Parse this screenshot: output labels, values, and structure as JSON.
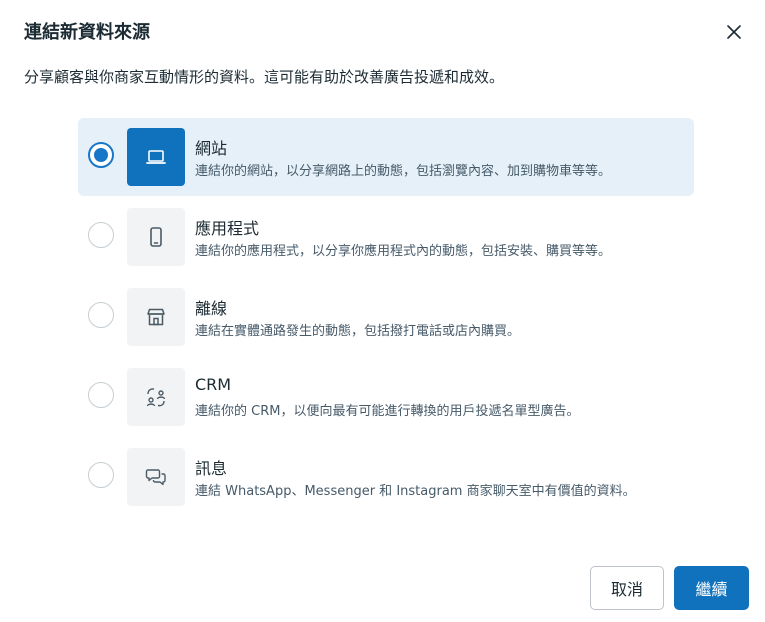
{
  "dialog": {
    "title": "連結新資料來源",
    "description": "分享顧客與你商家互動情形的資料。這可能有助於改善廣告投遞和成效。"
  },
  "options": [
    {
      "title": "網站",
      "description": "連結你的網站，以分享網路上的動態，包括瀏覽內容、加到購物車等等。",
      "icon": "laptop-icon",
      "selected": true
    },
    {
      "title": "應用程式",
      "description": "連結你的應用程式，以分享你應用程式內的動態，包括安裝、購買等等。",
      "icon": "phone-icon",
      "selected": false
    },
    {
      "title": "離線",
      "description": "連結在實體通路發生的動態，包括撥打電話或店內購買。",
      "icon": "store-icon",
      "selected": false
    },
    {
      "title": "CRM",
      "description": "連結你的 CRM，以便向最有可能進行轉換的用戶投遞名單型廣告。",
      "icon": "crm-people-icon",
      "selected": false
    },
    {
      "title": "訊息",
      "description": "連結 WhatsApp、Messenger 和 Instagram 商家聊天室中有價值的資料。",
      "icon": "chat-bubbles-icon",
      "selected": false
    }
  ],
  "footer": {
    "cancel_label": "取消",
    "continue_label": "繼續"
  },
  "colors": {
    "accent": "#1071bd",
    "selected_bg": "#e6f0f8",
    "text": "#1c2b33"
  }
}
